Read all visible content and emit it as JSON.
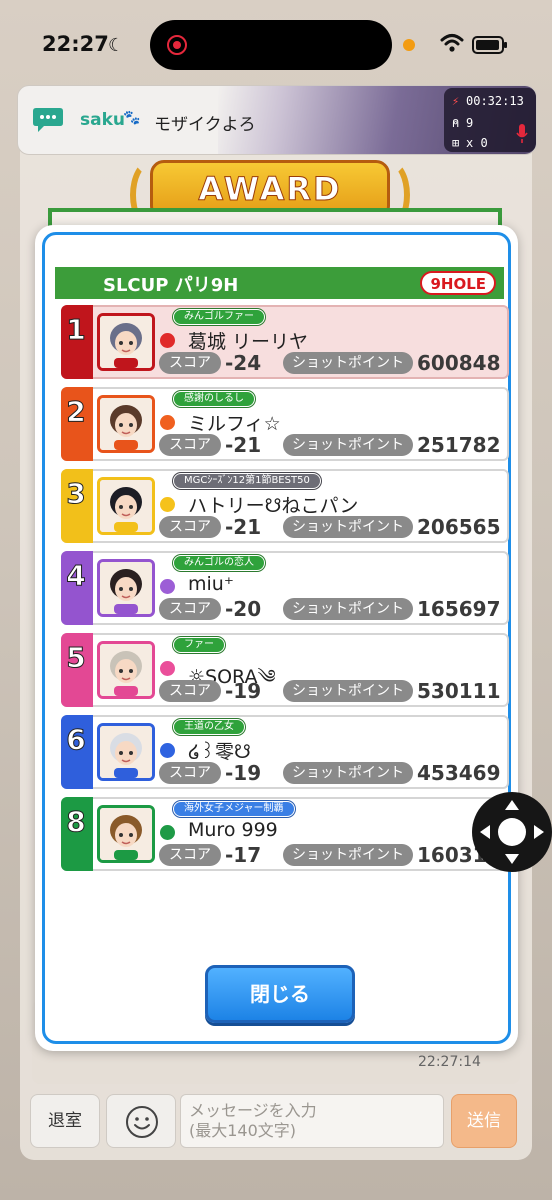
{
  "status_bar": {
    "time": "22:27"
  },
  "chat_bar": {
    "username": "saku",
    "message": "モザイクよろ",
    "timer": "00:32:13",
    "listeners": "9",
    "gifts": "x 0"
  },
  "background": {
    "award_text": "AWARD",
    "chat_timestamp": "22:27:14"
  },
  "leaderboard": {
    "course_name": "SLCUP パリ9H",
    "holes_badge": "9HOLE",
    "score_label": "スコア",
    "shot_points_label": "ショットポイント",
    "rows": [
      {
        "rank": "1",
        "title": "みんゴルファー",
        "name": "葛城 リーリヤ",
        "score": "-24",
        "shot_points": "600848",
        "dot_color": "#e02a2a",
        "rank_color": "#c0151c",
        "title_style": "green"
      },
      {
        "rank": "2",
        "title": "感謝のしるし",
        "name": "ミルフィ☆",
        "score": "-21",
        "shot_points": "251782",
        "dot_color": "#f06020",
        "rank_color": "#e8541b",
        "title_style": "green"
      },
      {
        "rank": "3",
        "title": "MGCｼｰｽﾞﾝ12第1節BEST50",
        "name": "ハトリー☋ねこパン",
        "score": "-21",
        "shot_points": "206565",
        "dot_color": "#f5c21b",
        "rank_color": "#f2c01a",
        "title_style": "gray"
      },
      {
        "rank": "4",
        "title": "みんゴルの恋人",
        "name": "miu⁺",
        "score": "-20",
        "shot_points": "165697",
        "dot_color": "#9c5ed6",
        "rank_color": "#9454cf",
        "title_style": "green"
      },
      {
        "rank": "5",
        "title": "ファー",
        "name": "☼SORA༄",
        "score": "-19",
        "shot_points": "530111",
        "dot_color": "#ea4f9a",
        "rank_color": "#e34894",
        "title_style": "green"
      },
      {
        "rank": "6",
        "title": "王道の乙女",
        "name": "໒꒱零☋",
        "score": "-19",
        "shot_points": "453469",
        "dot_color": "#2f63e0",
        "rank_color": "#2f5fdc",
        "title_style": "green"
      },
      {
        "rank": "8",
        "title": "海外女子メジャー制覇",
        "name": "Muro 999",
        "score": "-17",
        "shot_points": "160316",
        "dot_color": "#1e9a46",
        "rank_color": "#1c9a44",
        "title_style": "blue"
      }
    ],
    "close_label": "閉じる"
  },
  "input_bar": {
    "leave_label": "退室",
    "input_placeholder": "メッセージを入力\n(最大140文字)",
    "send_label": "送信"
  },
  "icons": [
    "moon-icon",
    "wifi-icon",
    "battery-icon",
    "chat-bubble-icon",
    "paw-icon",
    "bolt-icon",
    "user-icon",
    "gift-icon",
    "mic-icon",
    "emoji-icon",
    "dpad-icon"
  ]
}
